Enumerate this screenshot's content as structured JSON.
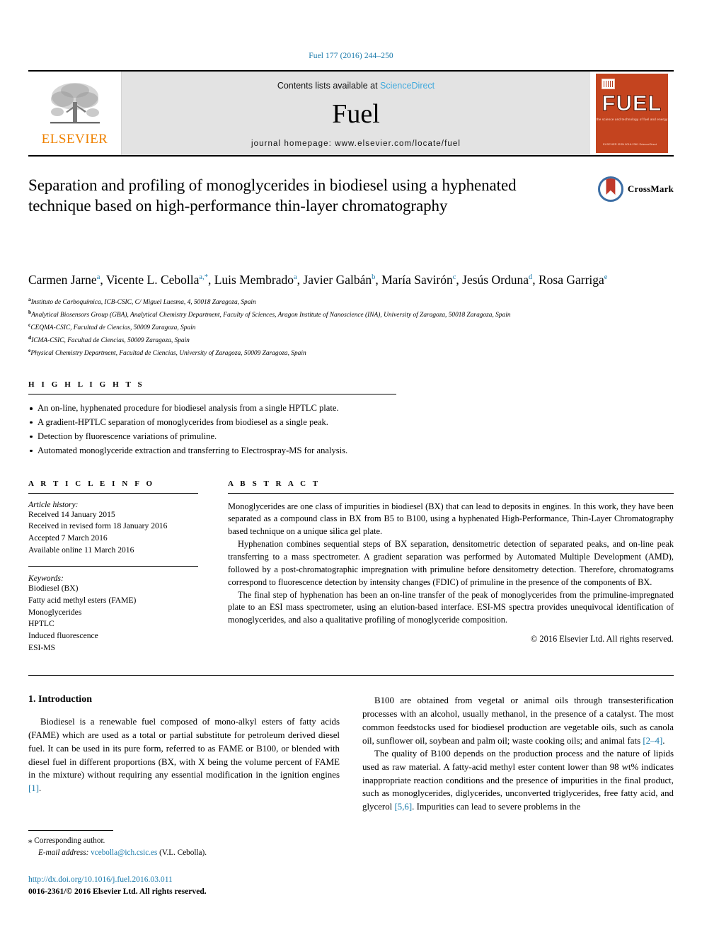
{
  "running_head": "Fuel 177 (2016) 244–250",
  "masthead": {
    "publisher_logo_label": "ELSEVIER",
    "contents_prefix": "Contents lists available at ",
    "contents_link": "ScienceDirect",
    "journal_name": "Fuel",
    "homepage": "journal homepage: www.elsevier.com/locate/fuel",
    "cover": {
      "title": "FUEL",
      "subtitle": "the science and technology of fuel and energy",
      "footer": "ELSEVIER ISSN 0016-2361\nScienceDirect"
    }
  },
  "article": {
    "title": "Separation and profiling of monoglycerides in biodiesel using a hyphenated technique based on high-performance thin-layer chromatography",
    "crossmark_label": "CrossMark",
    "authors_line1": "Carmen Jarne",
    "authors": [
      {
        "name": "Carmen Jarne",
        "marks": "a"
      },
      {
        "name": "Vicente L. Cebolla",
        "marks": "a,*"
      },
      {
        "name": "Luis Membrado",
        "marks": "a"
      },
      {
        "name": "Javier Galbán",
        "marks": "b"
      },
      {
        "name": "María Savirón",
        "marks": "c"
      },
      {
        "name": "Jesús Orduna",
        "marks": "d"
      },
      {
        "name": "Rosa Garriga",
        "marks": "e"
      }
    ],
    "affiliations": [
      {
        "mark": "a",
        "text": "Instituto de Carboquímica, ICB-CSIC, C/ Miguel Luesma, 4, 50018 Zaragoza, Spain"
      },
      {
        "mark": "b",
        "text": "Analytical Biosensors Group (GBA), Analytical Chemistry Department, Faculty of Sciences, Aragon Institute of Nanoscience (INA), University of Zaragoza, 50018 Zaragoza, Spain"
      },
      {
        "mark": "c",
        "text": "CEQMA-CSIC, Facultad de Ciencias, 50009 Zaragoza, Spain"
      },
      {
        "mark": "d",
        "text": "ICMA-CSIC, Facultad de Ciencias, 50009 Zaragoza, Spain"
      },
      {
        "mark": "e",
        "text": "Physical Chemistry Department, Facultad de Ciencias, University of Zaragoza, 50009 Zaragoza, Spain"
      }
    ]
  },
  "highlights": {
    "heading": "H I G H L I G H T S",
    "items": [
      "An on-line, hyphenated procedure for biodiesel analysis from a single HPTLC plate.",
      "A gradient-HPTLC separation of monoglycerides from biodiesel as a single peak.",
      "Detection by fluorescence variations of primuline.",
      "Automated monoglyceride extraction and transferring to Electrospray-MS for analysis."
    ]
  },
  "article_info": {
    "heading": "A R T I C L E    I N F O",
    "history_title": "Article history:",
    "history": [
      "Received 14 January 2015",
      "Received in revised form 18 January 2016",
      "Accepted 7 March 2016",
      "Available online 11 March 2016"
    ],
    "keywords_title": "Keywords:",
    "keywords": [
      "Biodiesel (BX)",
      "Fatty acid methyl esters (FAME)",
      "Monoglycerides",
      "HPTLC",
      "Induced fluorescence",
      "ESI-MS"
    ]
  },
  "abstract": {
    "heading": "A B S T R A C T",
    "paragraphs": [
      "Monoglycerides are one class of impurities in biodiesel (BX) that can lead to deposits in engines. In this work, they have been separated as a compound class in BX from B5 to B100, using a hyphenated High-Performance, Thin-Layer Chromatography based technique on a unique silica gel plate.",
      "Hyphenation combines sequential steps of BX separation, densitometric detection of separated peaks, and on-line peak transferring to a mass spectrometer. A gradient separation was performed by Automated Multiple Development (AMD), followed by a post-chromatographic impregnation with primuline before densitometry detection. Therefore, chromatograms correspond to fluorescence detection by intensity changes (FDIC) of primuline in the presence of the components of BX.",
      "The final step of hyphenation has been an on-line transfer of the peak of monoglycerides from the primuline-impregnated plate to an ESI mass spectrometer, using an elution-based interface. ESI-MS spectra provides unequivocal identification of monoglycerides, and also a qualitative profiling of monoglyceride composition."
    ],
    "copyright": "© 2016 Elsevier Ltd. All rights reserved."
  },
  "body": {
    "section_heading": "1. Introduction",
    "left_paragraphs": [
      {
        "pre": "Biodiesel is a renewable fuel composed of mono-alkyl esters of fatty acids (FAME) which are used as a total or partial substitute for petroleum derived diesel fuel. It can be used in its pure form, referred to as FAME or B100, or blended with diesel fuel in different proportions (BX, with X being the volume percent of FAME in the mixture) without requiring any essential modification in the ignition engines ",
        "ref": "[1]",
        "post": "."
      }
    ],
    "right_paragraphs": [
      {
        "pre": "B100 are obtained from vegetal or animal oils through transesterification processes with an alcohol, usually methanol, in the presence of a catalyst. The most common feedstocks used for biodiesel production are vegetable oils, such as canola oil, sunflower oil, soybean and palm oil; waste cooking oils; and animal fats ",
        "ref": "[2–4]",
        "post": "."
      },
      {
        "pre": "The quality of B100 depends on the production process and the nature of lipids used as raw material. A fatty-acid methyl ester content lower than 98 wt% indicates inappropriate reaction conditions and the presence of impurities in the final product, such as monoglycerides, diglycerides, unconverted triglycerides, free fatty acid, and glycerol ",
        "ref": "[5,6]",
        "post": ". Impurities can lead to severe problems in the"
      }
    ]
  },
  "footnote": {
    "corresponding_marker": "⁎",
    "corresponding_text": "Corresponding author.",
    "email_label": "E-mail address:",
    "email": "vcebolla@ich.csic.es",
    "email_suffix": "(V.L. Cebolla).",
    "doi": "http://dx.doi.org/10.1016/j.fuel.2016.03.011",
    "issn_line": "0016-2361/© 2016 Elsevier Ltd. All rights reserved."
  },
  "colors": {
    "link_blue": "#1a7aab",
    "science_direct_blue": "#3fa9dd",
    "elsevier_orange": "#ef8200",
    "cover_red": "#c4441f",
    "band_grey": "#e3e3e3"
  }
}
